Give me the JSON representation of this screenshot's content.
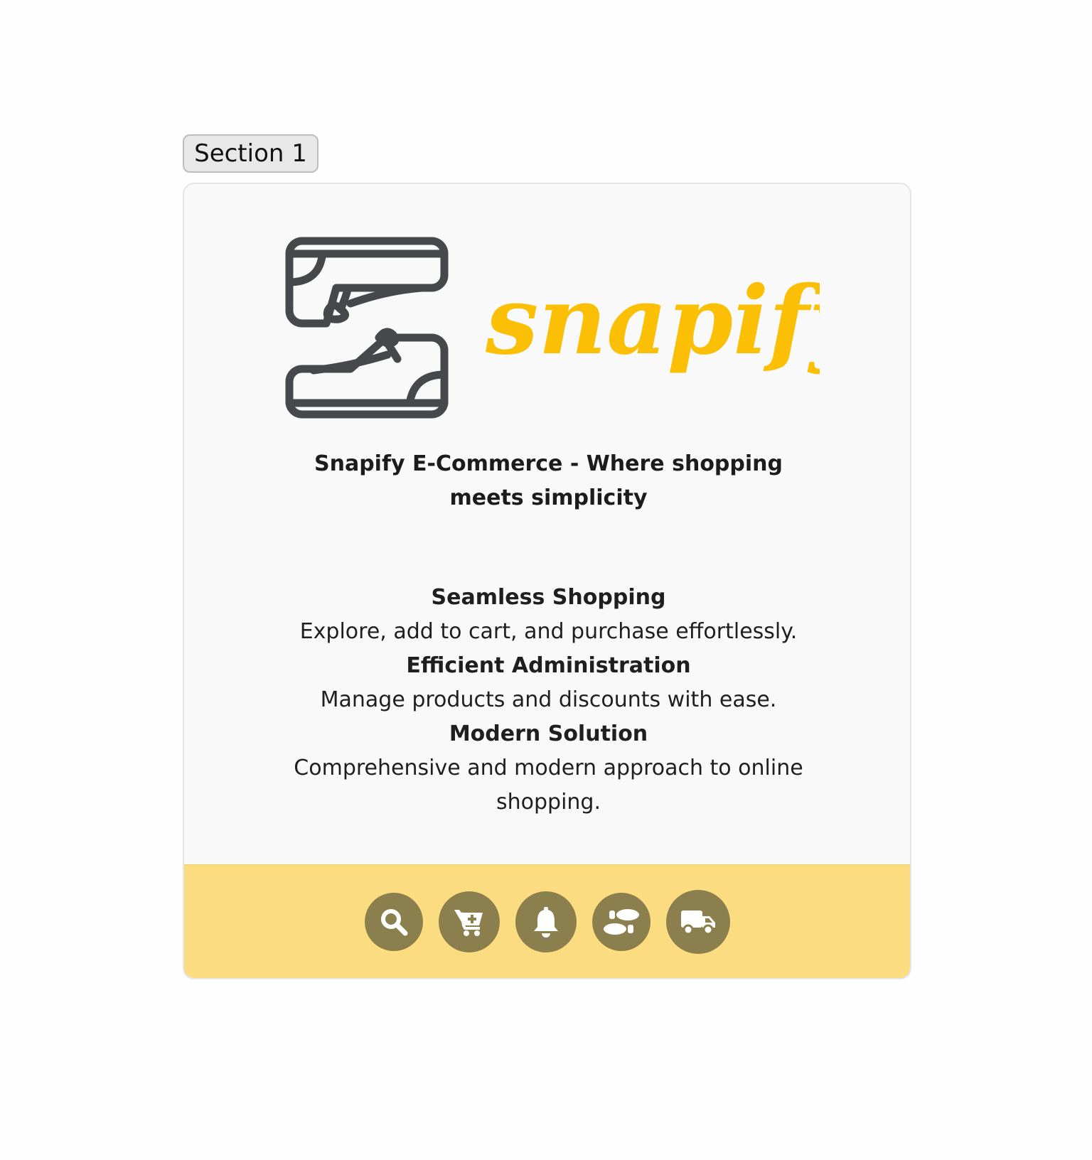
{
  "section_tab": {
    "label": "Section 1"
  },
  "brand": {
    "wordmark": "snapify",
    "tagline": "Snapify E-Commerce - Where shopping meets simplicity",
    "accent_color": "#fbbf06",
    "logo_color": "#46484b"
  },
  "features": [
    {
      "title": "Seamless Shopping",
      "desc": "Explore, add to cart, and purchase effortlessly."
    },
    {
      "title": "Efficient Administration",
      "desc": "Manage products and discounts with ease."
    },
    {
      "title": "Modern Solution",
      "desc": "Comprehensive and modern approach to online shopping."
    }
  ],
  "toolbar": {
    "background": "#fcdc80",
    "button_color": "#8b7f4d",
    "icons": [
      "search-icon",
      "cart-plus-icon",
      "bell-icon",
      "shoe-prints-icon",
      "truck-icon"
    ]
  }
}
